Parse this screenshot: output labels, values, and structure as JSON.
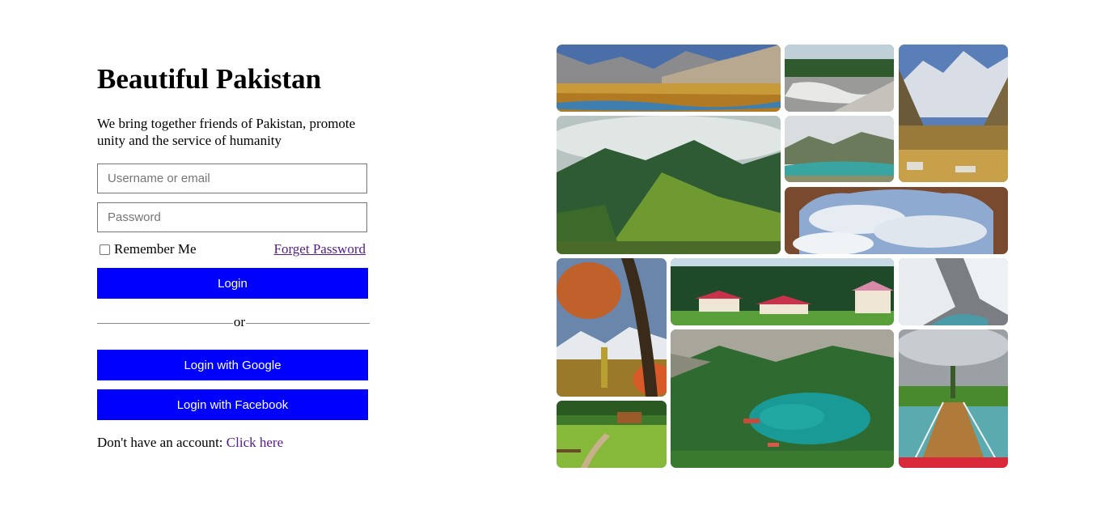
{
  "login": {
    "title": "Beautiful Pakistan",
    "subtitle": "We bring together friends of Pakistan, promote unity and the service of humanity",
    "username_placeholder": "Username or email",
    "password_placeholder": "Password",
    "remember_label": "Remember Me",
    "forget_label": "Forget Password",
    "login_button": "Login",
    "divider_text": "or",
    "google_button": "Login with Google",
    "facebook_button": "Login with Facebook",
    "signup_prompt": "Don't have an account: ",
    "signup_link": "Click here"
  },
  "colors": {
    "button_bg": "#0000ff",
    "button_text": "#ffffff",
    "link": "#551a8b"
  },
  "gallery": {
    "photos": [
      "valley-river-autumn",
      "waterfall-forest",
      "snow-peaks-village",
      "misty-forest-hill",
      "mountain-lake",
      "clouds-through-arch",
      "autumn-tree-mountains",
      "forest-cottages",
      "glacier-snow-slopes",
      "village-green-path",
      "emerald-lake-valley",
      "rope-bridge-river"
    ]
  }
}
